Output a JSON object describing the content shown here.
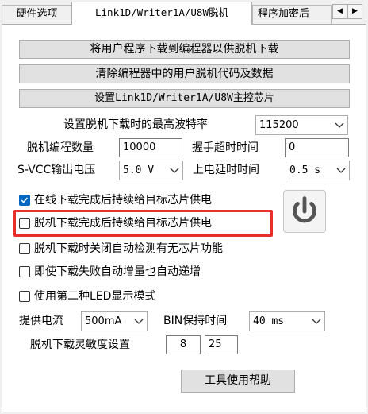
{
  "tabs": [
    {
      "label": "硬件选项"
    },
    {
      "label": "Link1D/Writer1A/U8W脱机"
    },
    {
      "label": "程序加密后"
    }
  ],
  "tab_scroll": {
    "left": "◀",
    "right": "▶"
  },
  "buttons": {
    "download": "将用户程序下载到编程器以供脱机下载",
    "clear": "清除编程器中的用户脱机代码及数据",
    "set_master": "设置Link1D/Writer1A/U8W主控芯片",
    "help": "工具使用帮助"
  },
  "baud": {
    "label": "设置脱机下载时的最高波特率",
    "value": "115200"
  },
  "offline_count": {
    "label": "脱机编程数量",
    "value": "10000"
  },
  "handshake": {
    "label": "握手超时时间",
    "value": "0"
  },
  "svcc": {
    "label": "S-VCC输出电压",
    "value": "5.0 V"
  },
  "power_delay": {
    "label": "上电延时时间",
    "value": "0.5 s"
  },
  "checkboxes": [
    {
      "label": "在线下载完成后持续给目标芯片供电",
      "checked": true
    },
    {
      "label": "脱机下载完成后持续给目标芯片供电",
      "checked": false
    },
    {
      "label": "脱机下载时关闭自动检测有无芯片功能",
      "checked": false
    },
    {
      "label": "即使下载失败自动增量也自动递增",
      "checked": false
    },
    {
      "label": "使用第二种LED显示模式",
      "checked": false
    }
  ],
  "current": {
    "label": "提供电流",
    "value": "500mA"
  },
  "bin_hold": {
    "label": "BIN保持时间",
    "value": "40 ms"
  },
  "sensitivity": {
    "label": "脱机下载灵敏度设置",
    "value1": "8",
    "value2": "25"
  },
  "colors": {
    "accent": "#0067c0",
    "highlight": "#e8302b",
    "icon": "#555555"
  },
  "icons": {
    "power": "power-icon",
    "dropdown": "chevron-down-icon",
    "check": "check-icon"
  }
}
